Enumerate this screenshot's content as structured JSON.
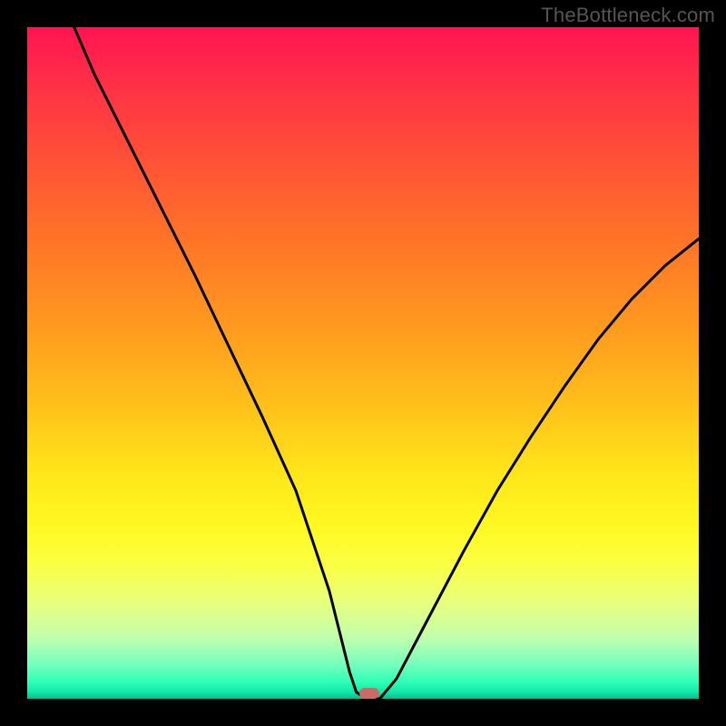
{
  "watermark": "TheBottleneck.com",
  "colors": {
    "page_bg": "#000000",
    "curve_stroke": "#000000",
    "marker_fill": "#cc6a66",
    "watermark_color": "#555555"
  },
  "chart_data": {
    "type": "line",
    "title": "",
    "xlabel": "",
    "ylabel": "",
    "xlim": [
      0,
      100
    ],
    "ylim": [
      0,
      100
    ],
    "grid": false,
    "legend": false,
    "series": [
      {
        "name": "bottleneck-curve",
        "x": [
          7,
          10,
          15,
          20,
          25,
          30,
          35,
          40,
          45,
          46,
          47,
          48,
          49,
          50.5,
          52.5,
          55,
          60,
          65,
          70,
          75,
          80,
          85,
          90,
          95,
          100
        ],
        "y": [
          100,
          93,
          83,
          73,
          63,
          52.5,
          42,
          31,
          16,
          12,
          8,
          4,
          1,
          0,
          0,
          3,
          12.5,
          22,
          31,
          39,
          46.5,
          53.5,
          59.5,
          64.5,
          68.5
        ]
      }
    ],
    "optimum_marker": {
      "x": 51,
      "y": 0.8
    },
    "background_gradient_stops": [
      {
        "pos": 0.0,
        "color": "#ff1452"
      },
      {
        "pos": 0.2,
        "color": "#ff5236"
      },
      {
        "pos": 0.45,
        "color": "#ff981f"
      },
      {
        "pos": 0.66,
        "color": "#ffe41a"
      },
      {
        "pos": 0.86,
        "color": "#e6ff80"
      },
      {
        "pos": 0.97,
        "color": "#2effb7"
      },
      {
        "pos": 1.0,
        "color": "#0cb88f"
      }
    ]
  }
}
